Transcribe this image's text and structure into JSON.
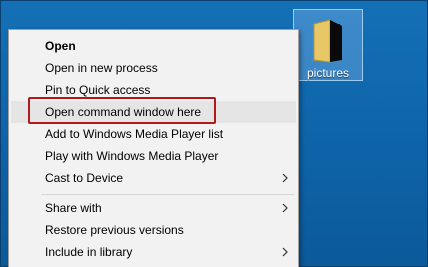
{
  "desktop": {
    "folder_label": "pictures",
    "folder_icon": "folder-icon"
  },
  "menu": {
    "items": [
      {
        "label": "Open"
      },
      {
        "label": "Open in new process"
      },
      {
        "label": "Pin to Quick access"
      },
      {
        "label": "Open command window here"
      },
      {
        "label": "Add to Windows Media Player list"
      },
      {
        "label": "Play with Windows Media Player"
      },
      {
        "label": "Cast to Device",
        "submenu_icon": "chevron-right-icon"
      },
      {
        "label": "Share with",
        "submenu_icon": "chevron-right-icon"
      },
      {
        "label": "Restore previous versions"
      },
      {
        "label": "Include in library",
        "submenu_icon": "chevron-right-icon"
      }
    ]
  },
  "colors": {
    "desktop_background": "#0f5e9e",
    "menu_background": "#f2f2f2",
    "highlight_border": "#b11a1a"
  }
}
